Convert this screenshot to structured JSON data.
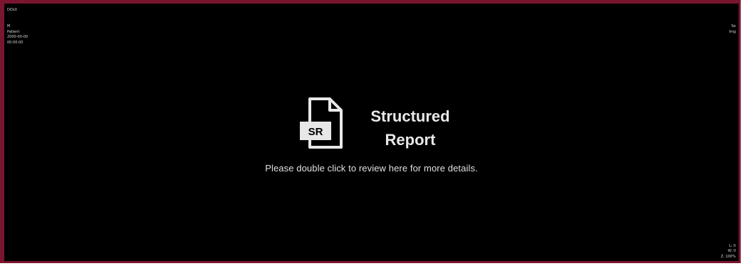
{
  "viewport": {
    "border_color": "#7a1530",
    "background_color": "#000000",
    "top_left_label": "DOx0",
    "top_left_lines": [
      "M",
      "Patient",
      "2000-00-00",
      "00:00:00"
    ],
    "top_right_lines": [
      "Se",
      "Img"
    ],
    "bottom_right_lines": [
      "L: 0",
      "W: 0",
      "Z: 100%"
    ]
  },
  "placeholder": {
    "icon": "sr-document-icon",
    "icon_text": "SR",
    "title": "Structured Report",
    "hint": "Please double click to review here for more details."
  }
}
